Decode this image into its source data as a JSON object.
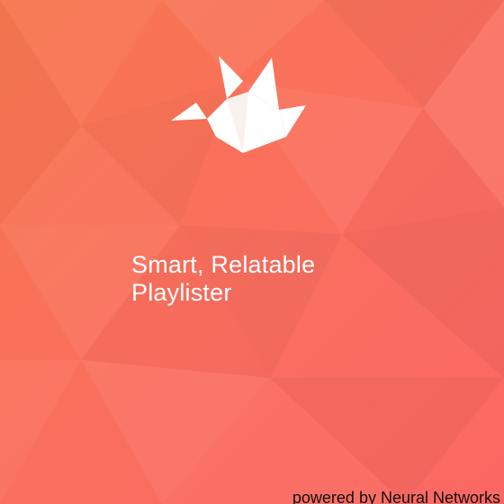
{
  "splash": {
    "logo_icon": "origami-crane-icon",
    "tagline_line1": "Smart, Relatable",
    "tagline_line2": "Playlister",
    "footer": "powered by Neural Networks"
  },
  "colors": {
    "background_start": "#f7774f",
    "background_end": "#fb6864",
    "text": "#ffffff",
    "footer_text": "#111111"
  }
}
